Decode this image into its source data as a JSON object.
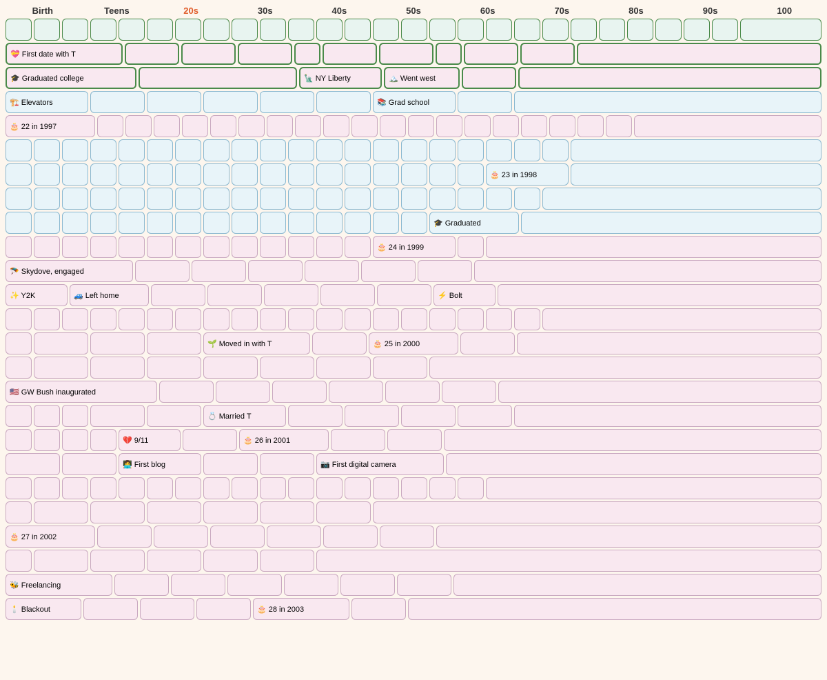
{
  "header": {
    "columns": [
      {
        "label": "Birth",
        "highlight": false
      },
      {
        "label": "Teens",
        "highlight": false
      },
      {
        "label": "20s",
        "highlight": true
      },
      {
        "label": "30s",
        "highlight": false
      },
      {
        "label": "40s",
        "highlight": false
      },
      {
        "label": "50s",
        "highlight": false
      },
      {
        "label": "60s",
        "highlight": false
      },
      {
        "label": "70s",
        "highlight": false
      },
      {
        "label": "80s",
        "highlight": false
      },
      {
        "label": "90s",
        "highlight": false
      },
      {
        "label": "100",
        "highlight": false
      }
    ]
  },
  "events": {
    "first_date": "💝 First date with T",
    "graduated_college": "🎓 Graduated college",
    "ny_liberty": "🗽 NY Liberty",
    "went_west": "🏔️ Went west",
    "elevators": "🏗️ Elevators",
    "grad_school": "📚 Grad school",
    "age22": "🎂 22 in 1997",
    "age23": "🎂 23 in 1998",
    "graduated": "🎓 Graduated",
    "age24": "🎂 24 in 1999",
    "skydove": "🪂 Skydove, engaged",
    "y2k": "✨ Y2K",
    "left_home": "🚙 Left home",
    "bolt": "⚡ Bolt",
    "moved_in": "🌱 Moved in with T",
    "age25": "🎂 25 in 2000",
    "gw_bush": "🇺🇸 GW Bush inaugurated",
    "married": "💍 Married T",
    "nine11": "💔 9/11",
    "age26": "🎂 26 in 2001",
    "first_blog": "👩‍💻 First blog",
    "first_digital": "📷 First digital camera",
    "age27": "🎂 27 in 2002",
    "freelancing": "🐝 Freelancing",
    "blackout": "🕯️ Blackout",
    "age28": "🎂 28 in 2003"
  }
}
